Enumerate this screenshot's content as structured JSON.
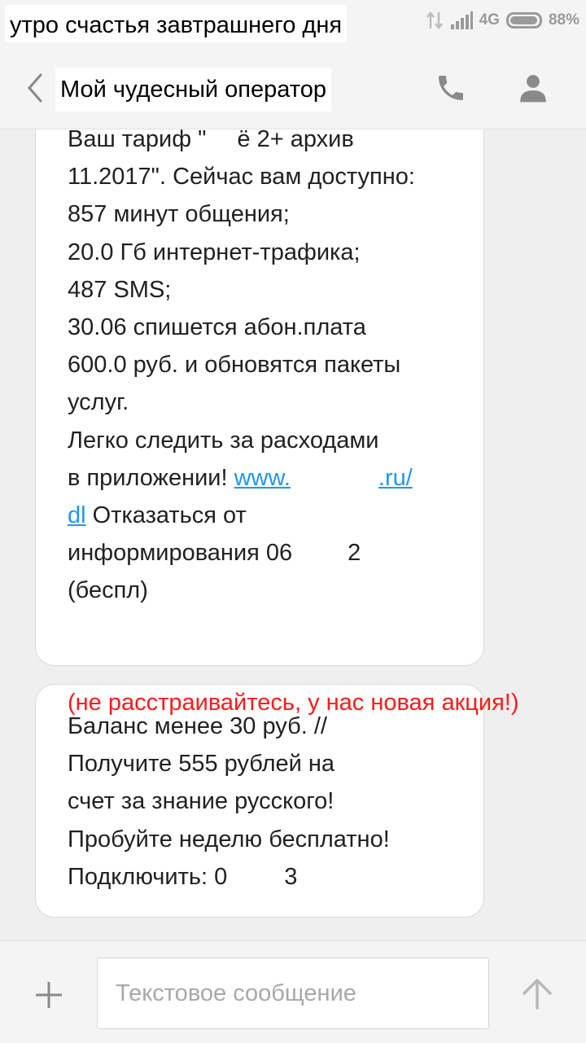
{
  "caption": "утро счастья завтрашнего дня",
  "status_bar": {
    "network": "4G",
    "battery": "88%",
    "battery_level": 0.88
  },
  "header": {
    "title": "Мой чудесный оператор",
    "icons": [
      "back-icon",
      "phone-icon",
      "contact-icon"
    ]
  },
  "messages": [
    {
      "lines": {
        "l1a": "Ваш тариф \"",
        "l1b": "ё 2+ архив",
        "l2": "11.2017\". Сейчас вам доступно:",
        "l3": "857 минут общения;",
        "l4": "20.0 Гб интернет-трафика;",
        "l5": "487 SMS;",
        "l6": "30.06 спишется абон.плата",
        "l7": "600.0 руб. и обновятся пакеты",
        "l8": "услуг.",
        "l9": "Легко следить за расходами",
        "l10a": "в приложении! ",
        "link_a": "www.",
        "link_b": ".ru/",
        "link_c": "dl",
        "l11b": " Отказаться от",
        "l12a": "информирования 06",
        "l12b": "2",
        "l13": "(беспл)"
      }
    },
    {
      "lines": {
        "l1": "Баланс менее 30 руб. //",
        "l2": "Получите 555 рублей на",
        "l3": "счет за знание русского!",
        "l4": "Пробуйте неделю бесплатно!",
        "l5a": "Подключить: 0",
        "l5b": "3"
      }
    }
  ],
  "promo": "(не расстраивайтесь, у нас новая акция!)",
  "composer": {
    "placeholder": "Текстовое сообщение",
    "icons": [
      "plus-icon",
      "send-arrow-icon"
    ]
  },
  "colors": {
    "link": "#2196f3",
    "promo": "#ff1a1a",
    "icon": "#9e9e9e"
  }
}
